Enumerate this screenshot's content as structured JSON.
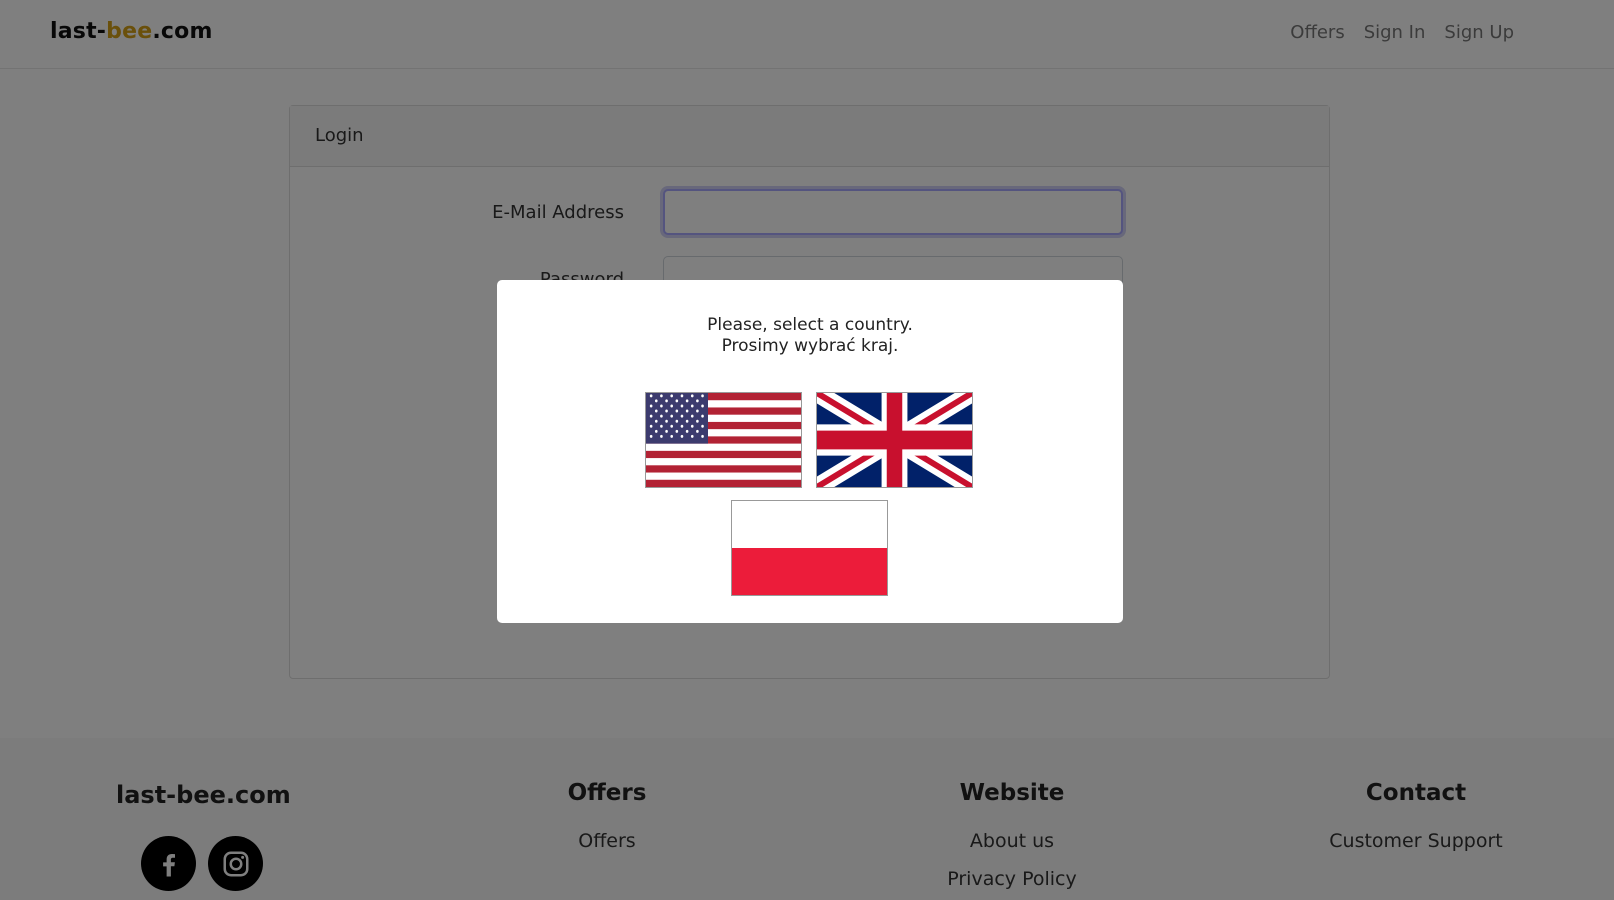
{
  "navbar": {
    "brand": {
      "part1": "last-",
      "part2": "bee",
      "part3": ".com"
    },
    "links": [
      {
        "label": "Offers"
      },
      {
        "label": "Sign In"
      },
      {
        "label": "Sign Up"
      }
    ]
  },
  "login": {
    "header": "Login",
    "email_label": "E-Mail Address",
    "email_value": "",
    "password_label": "Password",
    "password_value": ""
  },
  "modal": {
    "line1": "Please, select a country.",
    "line2": "Prosimy wybrać kraj.",
    "flags": [
      {
        "icon": "us-flag-icon"
      },
      {
        "icon": "uk-flag-icon"
      },
      {
        "icon": "pl-flag-icon"
      }
    ]
  },
  "footer": {
    "brand": "last-bee.com",
    "social": [
      {
        "icon": "facebook-icon"
      },
      {
        "icon": "instagram-icon"
      }
    ],
    "columns": [
      {
        "title": "Offers",
        "links": [
          "Offers"
        ]
      },
      {
        "title": "Website",
        "links": [
          "About us",
          "Privacy Policy"
        ]
      },
      {
        "title": "Contact",
        "links": [
          "Customer Support"
        ]
      }
    ]
  },
  "colors": {
    "brand_accent": "#d4a017",
    "overlay": "rgba(0,0,0,0.5)"
  }
}
